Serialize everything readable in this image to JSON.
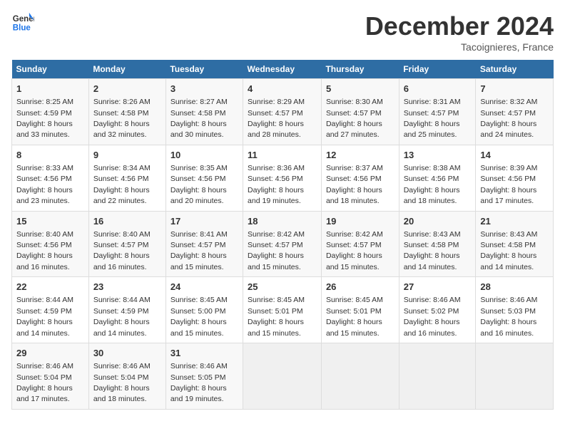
{
  "header": {
    "logo_line1": "General",
    "logo_line2": "Blue",
    "month_title": "December 2024",
    "location": "Tacoignieres, France"
  },
  "weekdays": [
    "Sunday",
    "Monday",
    "Tuesday",
    "Wednesday",
    "Thursday",
    "Friday",
    "Saturday"
  ],
  "weeks": [
    [
      {
        "day": "1",
        "rise": "8:25 AM",
        "set": "4:59 PM",
        "daylight": "8 hours and 33 minutes."
      },
      {
        "day": "2",
        "rise": "8:26 AM",
        "set": "4:58 PM",
        "daylight": "8 hours and 32 minutes."
      },
      {
        "day": "3",
        "rise": "8:27 AM",
        "set": "4:58 PM",
        "daylight": "8 hours and 30 minutes."
      },
      {
        "day": "4",
        "rise": "8:29 AM",
        "set": "4:57 PM",
        "daylight": "8 hours and 28 minutes."
      },
      {
        "day": "5",
        "rise": "8:30 AM",
        "set": "4:57 PM",
        "daylight": "8 hours and 27 minutes."
      },
      {
        "day": "6",
        "rise": "8:31 AM",
        "set": "4:57 PM",
        "daylight": "8 hours and 25 minutes."
      },
      {
        "day": "7",
        "rise": "8:32 AM",
        "set": "4:57 PM",
        "daylight": "8 hours and 24 minutes."
      }
    ],
    [
      {
        "day": "8",
        "rise": "8:33 AM",
        "set": "4:56 PM",
        "daylight": "8 hours and 23 minutes."
      },
      {
        "day": "9",
        "rise": "8:34 AM",
        "set": "4:56 PM",
        "daylight": "8 hours and 22 minutes."
      },
      {
        "day": "10",
        "rise": "8:35 AM",
        "set": "4:56 PM",
        "daylight": "8 hours and 20 minutes."
      },
      {
        "day": "11",
        "rise": "8:36 AM",
        "set": "4:56 PM",
        "daylight": "8 hours and 19 minutes."
      },
      {
        "day": "12",
        "rise": "8:37 AM",
        "set": "4:56 PM",
        "daylight": "8 hours and 18 minutes."
      },
      {
        "day": "13",
        "rise": "8:38 AM",
        "set": "4:56 PM",
        "daylight": "8 hours and 18 minutes."
      },
      {
        "day": "14",
        "rise": "8:39 AM",
        "set": "4:56 PM",
        "daylight": "8 hours and 17 minutes."
      }
    ],
    [
      {
        "day": "15",
        "rise": "8:40 AM",
        "set": "4:56 PM",
        "daylight": "8 hours and 16 minutes."
      },
      {
        "day": "16",
        "rise": "8:40 AM",
        "set": "4:57 PM",
        "daylight": "8 hours and 16 minutes."
      },
      {
        "day": "17",
        "rise": "8:41 AM",
        "set": "4:57 PM",
        "daylight": "8 hours and 15 minutes."
      },
      {
        "day": "18",
        "rise": "8:42 AM",
        "set": "4:57 PM",
        "daylight": "8 hours and 15 minutes."
      },
      {
        "day": "19",
        "rise": "8:42 AM",
        "set": "4:57 PM",
        "daylight": "8 hours and 15 minutes."
      },
      {
        "day": "20",
        "rise": "8:43 AM",
        "set": "4:58 PM",
        "daylight": "8 hours and 14 minutes."
      },
      {
        "day": "21",
        "rise": "8:43 AM",
        "set": "4:58 PM",
        "daylight": "8 hours and 14 minutes."
      }
    ],
    [
      {
        "day": "22",
        "rise": "8:44 AM",
        "set": "4:59 PM",
        "daylight": "8 hours and 14 minutes."
      },
      {
        "day": "23",
        "rise": "8:44 AM",
        "set": "4:59 PM",
        "daylight": "8 hours and 14 minutes."
      },
      {
        "day": "24",
        "rise": "8:45 AM",
        "set": "5:00 PM",
        "daylight": "8 hours and 15 minutes."
      },
      {
        "day": "25",
        "rise": "8:45 AM",
        "set": "5:01 PM",
        "daylight": "8 hours and 15 minutes."
      },
      {
        "day": "26",
        "rise": "8:45 AM",
        "set": "5:01 PM",
        "daylight": "8 hours and 15 minutes."
      },
      {
        "day": "27",
        "rise": "8:46 AM",
        "set": "5:02 PM",
        "daylight": "8 hours and 16 minutes."
      },
      {
        "day": "28",
        "rise": "8:46 AM",
        "set": "5:03 PM",
        "daylight": "8 hours and 16 minutes."
      }
    ],
    [
      {
        "day": "29",
        "rise": "8:46 AM",
        "set": "5:04 PM",
        "daylight": "8 hours and 17 minutes."
      },
      {
        "day": "30",
        "rise": "8:46 AM",
        "set": "5:04 PM",
        "daylight": "8 hours and 18 minutes."
      },
      {
        "day": "31",
        "rise": "8:46 AM",
        "set": "5:05 PM",
        "daylight": "8 hours and 19 minutes."
      },
      null,
      null,
      null,
      null
    ]
  ],
  "labels": {
    "sunrise": "Sunrise:",
    "sunset": "Sunset:",
    "daylight": "Daylight:"
  }
}
